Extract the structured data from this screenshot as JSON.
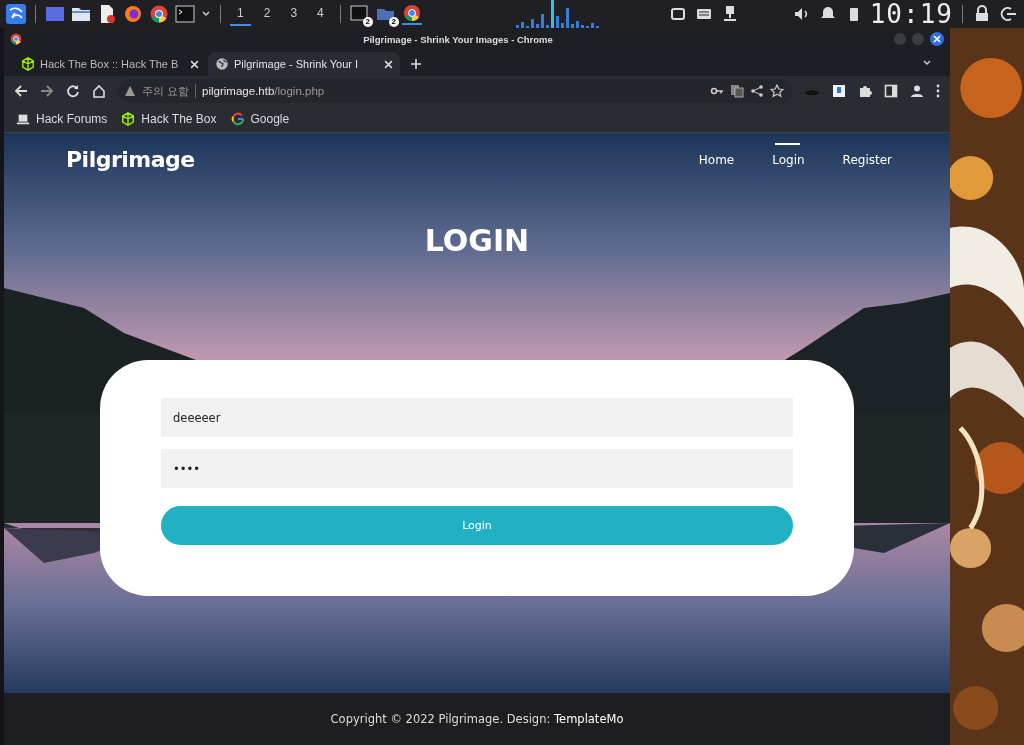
{
  "taskbar": {
    "workspaces": [
      {
        "label": "1",
        "selected": true
      },
      {
        "label": "2",
        "selected": false
      },
      {
        "label": "3",
        "selected": false
      },
      {
        "label": "4",
        "selected": false
      }
    ],
    "window_badges": [
      "2",
      "2"
    ],
    "clock": "10:19"
  },
  "window": {
    "title": "Pilgrimage - Shrink Your Images - Chrome"
  },
  "tabs": [
    {
      "title": "Hack The Box :: Hack The B",
      "kind": "cube",
      "selected": false
    },
    {
      "title": "Pilgrimage - Shrink Your I",
      "kind": "globe",
      "selected": true
    }
  ],
  "address_bar": {
    "warning": "주의 요함",
    "host": "pilgrimage.htb",
    "path": "/login.php"
  },
  "bookmarks": [
    {
      "label": "Hack Forums",
      "kind": "laptop"
    },
    {
      "label": "Hack The Box",
      "kind": "cube"
    },
    {
      "label": "Google",
      "kind": "google"
    }
  ],
  "site": {
    "logo": "Pilgrimage",
    "nav": [
      {
        "label": "Home",
        "selected": false
      },
      {
        "label": "Login",
        "selected": true
      },
      {
        "label": "Register",
        "selected": false
      }
    ],
    "heading": "LOGIN",
    "form": {
      "username": {
        "value": "deeeeer"
      },
      "password": {
        "value": "••••"
      },
      "submit": "Login"
    },
    "footer": {
      "text": "Copyright © 2022 Pilgrimage. Design: ",
      "link": "TemplateMo"
    }
  }
}
